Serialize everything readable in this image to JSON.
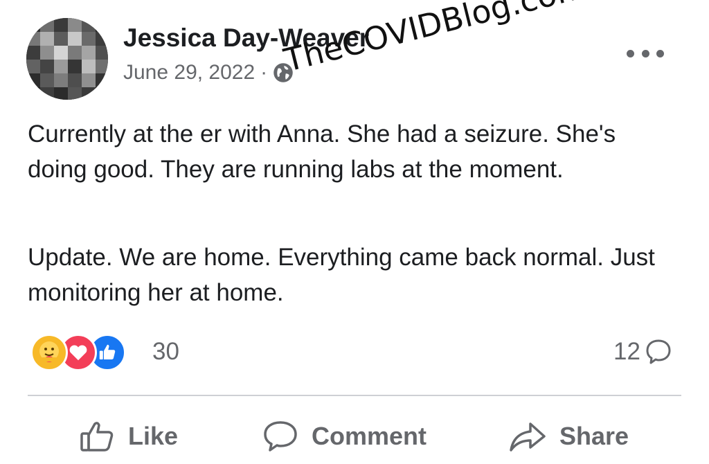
{
  "post": {
    "author": "Jessica Day-Weaver",
    "date": "June 29, 2022",
    "separator": "·",
    "audience_icon": "globe-icon",
    "more_icon": "more-options-icon",
    "paragraphs": [
      "Currently at the er with Anna. She had a seizure. She's doing good. They are running labs at the moment.",
      "Update. We are home. Everything came back normal.  Just monitoring her at home."
    ]
  },
  "watermark": "TheCOVIDBlog.com",
  "engagement": {
    "reaction_icons": [
      "care-icon",
      "love-icon",
      "like-icon"
    ],
    "reaction_count": "30",
    "comment_count": "12",
    "comment_icon": "comment-bubble-icon"
  },
  "actions": {
    "like_label": "Like",
    "comment_label": "Comment",
    "share_label": "Share"
  },
  "colors": {
    "text": "#1c1e21",
    "secondary": "#65676b",
    "like_blue": "#1877f2",
    "love_red": "#f33e58",
    "care_yellow": "#f7b928",
    "divider": "#ced0d4"
  }
}
